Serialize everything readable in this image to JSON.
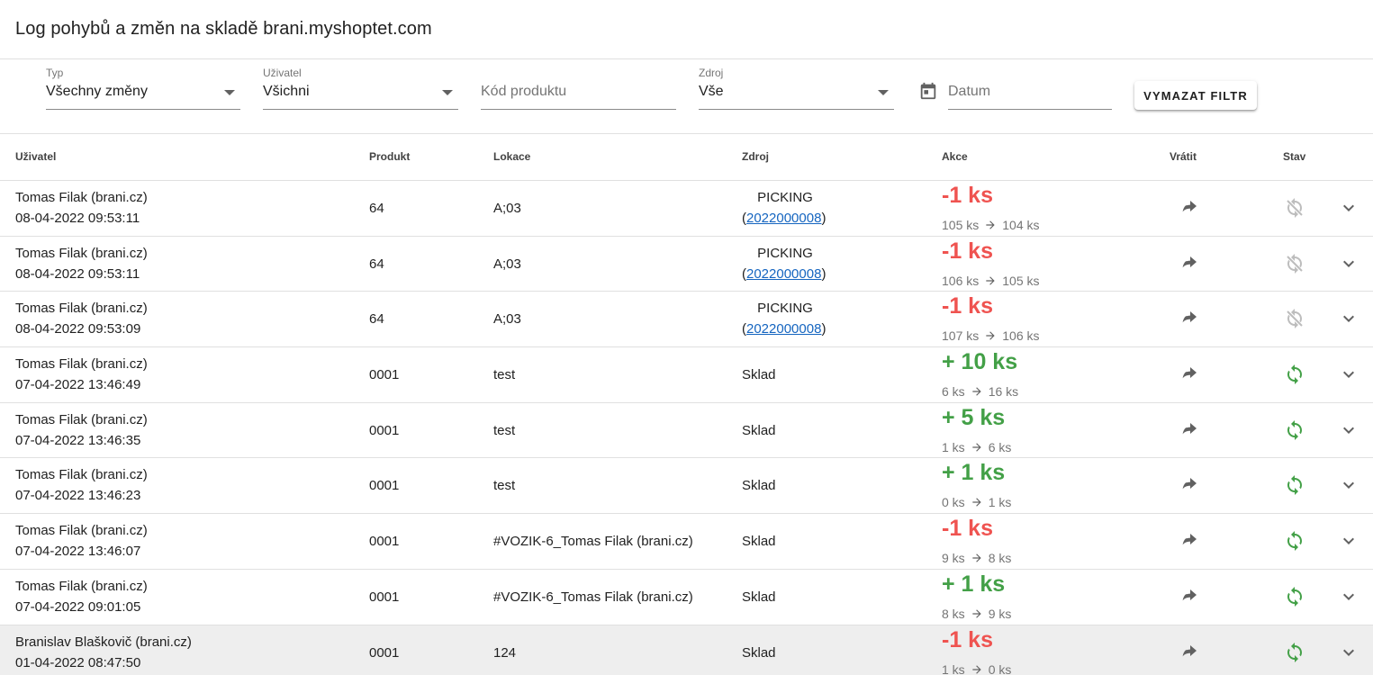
{
  "page": {
    "title": "Log pohybů a změn na skladě brani.myshoptet.com"
  },
  "filters": {
    "type": {
      "label": "Typ",
      "value": "Všechny změny"
    },
    "user": {
      "label": "Uživatel",
      "value": "Všichni"
    },
    "product_code": {
      "placeholder": "Kód produktu"
    },
    "source": {
      "label": "Zdroj",
      "value": "Vše"
    },
    "date": {
      "placeholder": "Datum",
      "icon": "calendar-icon"
    },
    "clear_button": "VYMAZAT FILTR"
  },
  "table": {
    "headers": {
      "user": "Uživatel",
      "product": "Produkt",
      "location": "Lokace",
      "source": "Zdroj",
      "action": "Akce",
      "revert": "Vrátit",
      "state": "Stav"
    },
    "colors": {
      "negative": "#ef5350",
      "positive": "#43a047",
      "state_ok": "#43a047",
      "state_disabled": "#bdbdbd",
      "link": "#1565c0",
      "highlight_row": "#eeeeee"
    },
    "rows": [
      {
        "user": "Tomas Filak (brani.cz)",
        "datetime": "08-04-2022 09:53:11",
        "product": "64",
        "location": "A;03",
        "source": "PICKING",
        "source_link": "2022000008",
        "action": "-1 ks",
        "from": "105 ks",
        "to": "104 ks",
        "state": "disabled"
      },
      {
        "user": "Tomas Filak (brani.cz)",
        "datetime": "08-04-2022 09:53:11",
        "product": "64",
        "location": "A;03",
        "source": "PICKING",
        "source_link": "2022000008",
        "action": "-1 ks",
        "from": "106 ks",
        "to": "105 ks",
        "state": "disabled"
      },
      {
        "user": "Tomas Filak (brani.cz)",
        "datetime": "08-04-2022 09:53:09",
        "product": "64",
        "location": "A;03",
        "source": "PICKING",
        "source_link": "2022000008",
        "action": "-1 ks",
        "from": "107 ks",
        "to": "106 ks",
        "state": "disabled"
      },
      {
        "user": "Tomas Filak (brani.cz)",
        "datetime": "07-04-2022 13:46:49",
        "product": "0001",
        "location": "test",
        "source": "Sklad",
        "source_link": "",
        "action": "+ 10 ks",
        "from": "6 ks",
        "to": "16 ks",
        "state": "ok"
      },
      {
        "user": "Tomas Filak (brani.cz)",
        "datetime": "07-04-2022 13:46:35",
        "product": "0001",
        "location": "test",
        "source": "Sklad",
        "source_link": "",
        "action": "+ 5 ks",
        "from": "1 ks",
        "to": "6 ks",
        "state": "ok"
      },
      {
        "user": "Tomas Filak (brani.cz)",
        "datetime": "07-04-2022 13:46:23",
        "product": "0001",
        "location": "test",
        "source": "Sklad",
        "source_link": "",
        "action": "+ 1 ks",
        "from": "0 ks",
        "to": "1 ks",
        "state": "ok"
      },
      {
        "user": "Tomas Filak (brani.cz)",
        "datetime": "07-04-2022 13:46:07",
        "product": "0001",
        "location": "#VOZIK-6_Tomas Filak (brani.cz)",
        "source": "Sklad",
        "source_link": "",
        "action": "-1 ks",
        "from": "9 ks",
        "to": "8 ks",
        "state": "ok"
      },
      {
        "user": "Tomas Filak (brani.cz)",
        "datetime": "07-04-2022 09:01:05",
        "product": "0001",
        "location": "#VOZIK-6_Tomas Filak (brani.cz)",
        "source": "Sklad",
        "source_link": "",
        "action": "+ 1 ks",
        "from": "8 ks",
        "to": "9 ks",
        "state": "ok"
      },
      {
        "user": "Branislav Blaškovič (brani.cz)",
        "datetime": "01-04-2022 08:47:50",
        "product": "0001",
        "location": "124",
        "source": "Sklad",
        "source_link": "",
        "action": "-1 ks",
        "from": "1 ks",
        "to": "0 ks",
        "state": "ok",
        "highlighted": true
      }
    ]
  }
}
